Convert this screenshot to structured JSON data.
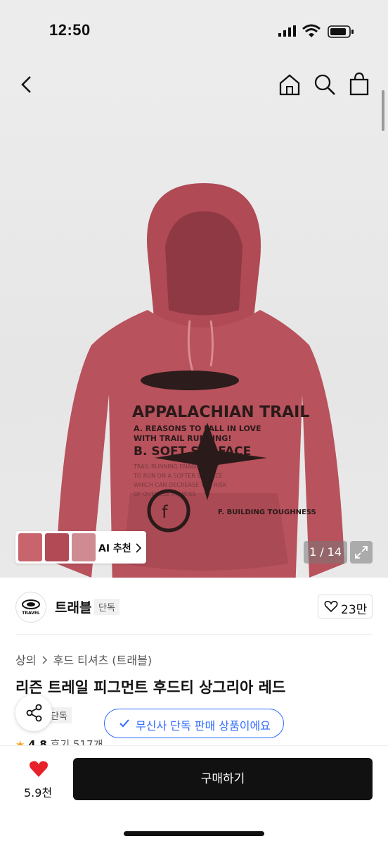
{
  "status_bar": {
    "time": "12:50"
  },
  "gallery": {
    "counter": "1 / 14",
    "ai_label": "AI 추천",
    "print_lines": [
      "APPALACHIAN TRAIL",
      "A. REASONS TO FALL IN LOVE",
      "WITH TRAIL RUNNING!",
      "B. SOFT SURFACE",
      "F. BUILDING TOUGHNESS"
    ]
  },
  "brand": {
    "name": "트래블",
    "badge": "단독",
    "logo_text": "TRAVEL",
    "likes": "23만"
  },
  "product": {
    "breadcrumb": [
      "상의",
      "후드 티셔츠 (트래블)"
    ],
    "title": "리즌 트레일 피그먼트 후드티 상그리아 레드",
    "badge": "단독",
    "rating": "4.8",
    "review_label": "후기 517개",
    "exclusive_notice": "무신사 단독 판매 상품이에요"
  },
  "bottom_bar": {
    "likes": "5.9천",
    "buy_label": "구매하기"
  },
  "colors": {
    "accent": "#2f6bff",
    "hoodie": "#b8525c",
    "star": "#f5a623",
    "heart": "#e8202a"
  }
}
